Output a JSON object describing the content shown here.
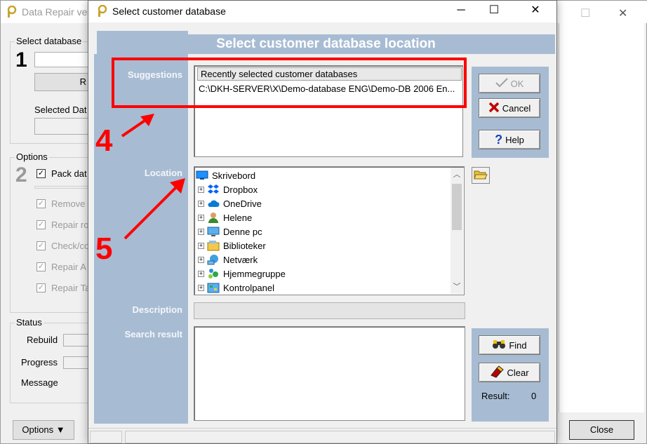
{
  "background_window": {
    "title": "Data Repair ve",
    "close_label": "✕",
    "groups": {
      "select_database": {
        "label": "Select database",
        "number": "1",
        "button_partial": "R",
        "selected_label": "Selected Dat"
      },
      "options": {
        "label": "Options",
        "number": "2",
        "pack_label": "Pack dat",
        "items": [
          "Remove",
          "Repair ro",
          "Check/co",
          "Repair A",
          "Repair Ta"
        ]
      },
      "status": {
        "label": "Status",
        "rebuild_label": "Rebuild",
        "progress_label": "Progress",
        "message_label": "Message"
      }
    },
    "options_button": "Options ▼",
    "close_button": "Close"
  },
  "dialog": {
    "title": "Select customer database",
    "minimize": "─",
    "maximize": "☐",
    "close": "✕",
    "banner": "Select customer database location",
    "labels": {
      "suggestions": "Suggestions",
      "location": "Location",
      "description": "Description",
      "search_result": "Search result"
    },
    "suggestions": {
      "header": "Recently selected customer databases",
      "items": [
        "C:\\DKH-SERVER\\X\\Demo-database ENG\\Demo-DB 2006 En..."
      ]
    },
    "buttons": {
      "ok": "OK",
      "cancel": "Cancel",
      "help": "Help",
      "find": "Find",
      "clear": "Clear"
    },
    "location_tree": [
      {
        "label": "Skrivebord",
        "icon": "desktop-icon",
        "expander": ""
      },
      {
        "label": "Dropbox",
        "icon": "dropbox-icon",
        "expander": "+"
      },
      {
        "label": "OneDrive",
        "icon": "cloud-icon",
        "expander": "+"
      },
      {
        "label": "Helene",
        "icon": "user-icon",
        "expander": "+"
      },
      {
        "label": "Denne pc",
        "icon": "computer-icon",
        "expander": "+"
      },
      {
        "label": "Biblioteker",
        "icon": "library-icon",
        "expander": "+"
      },
      {
        "label": "Netværk",
        "icon": "network-icon",
        "expander": "+"
      },
      {
        "label": "Hjemmegruppe",
        "icon": "homegroup-icon",
        "expander": "+"
      },
      {
        "label": "Kontrolpanel",
        "icon": "control-panel-icon",
        "expander": "+"
      }
    ],
    "result_label": "Result:",
    "result_count": "0"
  },
  "annotations": {
    "step4": "4",
    "step5": "5",
    "color": "#ff0000"
  }
}
